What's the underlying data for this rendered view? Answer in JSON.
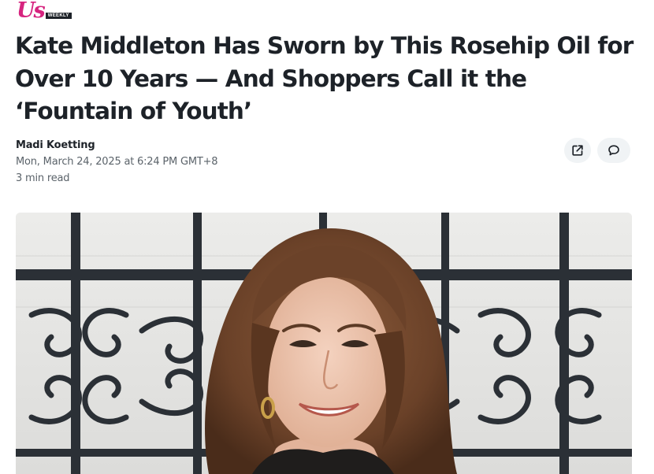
{
  "brand": {
    "logo_text": "Us",
    "logo_subtext": "WEEKLY",
    "accent_color": "#d6247f"
  },
  "article": {
    "headline": "Kate Middleton Has Sworn by This Rosehip Oil for Over 10 Years — And Shoppers Call it the ‘Fountain of Youth’",
    "author": "Madi Koetting",
    "date": "Mon, March 24, 2025 at 6:24 PM GMT+8",
    "read_time": "3 min read"
  },
  "actions": {
    "share_icon": "share-icon",
    "comment_icon": "comment-icon"
  },
  "hero_image": {
    "subject": "photo-woman-smiling-before-iron-gate"
  }
}
